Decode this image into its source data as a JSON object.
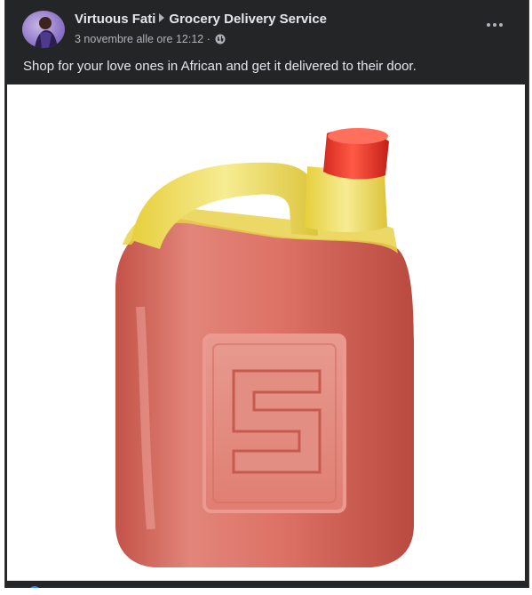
{
  "post": {
    "author_name": "Virtuous Fati",
    "group_name": "Grocery Delivery Service",
    "timestamp": "3 novembre alle ore 12:12",
    "separator": "·",
    "privacy_icon": "globe-icon",
    "more_icon": "more-options-icon",
    "text": "Shop for your love ones in African and get it delivered to their  door.",
    "image_label": "S"
  },
  "colors": {
    "background": "#242526",
    "primary_text": "#e4e6eb",
    "secondary_text": "#b0b3b8",
    "jug_body": "#d96a5e",
    "jug_handle": "#ecd54a",
    "jug_cap": "#e8362a"
  }
}
